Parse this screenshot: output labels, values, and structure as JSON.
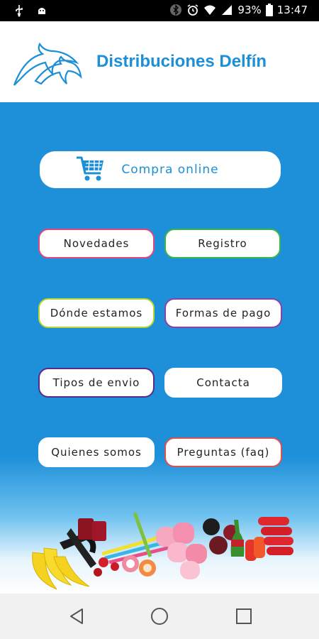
{
  "status_bar": {
    "battery": "93%",
    "time": "13:47",
    "icons": [
      "usb-icon",
      "android-debug-icon",
      "bluetooth-icon",
      "alarm-icon",
      "wifi-icon",
      "signal-icon",
      "battery-icon"
    ]
  },
  "header": {
    "brand": "Distribuciones Delfín",
    "logo_icon": "dolphins-logo-icon"
  },
  "menu": {
    "online": "Compra online",
    "novedades": "Novedades",
    "registro": "Registro",
    "donde": "Dónde estamos",
    "formas": "Formas de pago",
    "tipos": "Tipos de envio",
    "contacta": "Contacta",
    "quienes": "Quienes somos",
    "preguntas": "Preguntas (faq)"
  },
  "colors": {
    "brand": "#1d8fd6",
    "background": "#1e8fd9",
    "border_pink": "#e0477f",
    "border_green": "#39b54a",
    "border_yellowgreen": "#b8d52f",
    "border_purple": "#8e3fa5",
    "border_orange": "#f39237",
    "border_purple_dark": "#5a2a8a",
    "border_white": "#ffffff",
    "border_red": "#d9534f"
  }
}
